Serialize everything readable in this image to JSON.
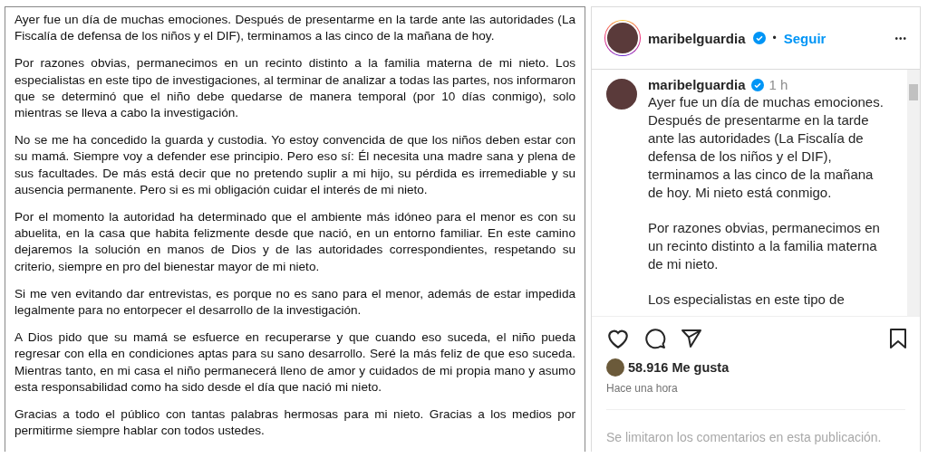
{
  "document": {
    "paragraphs": [
      "Ayer fue un día de muchas emociones. Después de presentarme en la tarde ante las autoridades (La Fiscalía de defensa de los niños y el DIF), terminamos a las cinco de la mañana de hoy.",
      "Por razones obvias, permanecimos en un recinto distinto a la familia materna de mi nieto. Los especialistas en este tipo de investigaciones, al terminar de analizar a todas las partes, nos informaron que se determinó que el niño debe quedarse de manera temporal (por 10 días conmigo), solo mientras se lleva a cabo la investigación.",
      "No se me ha concedido la guarda y custodia. Yo estoy convencida de que los niños deben estar con su mamá. Siempre voy a defender ese principio. Pero eso sí: Él necesita una madre sana y plena de sus facultades. De más está decir que no pretendo suplir a mi hijo, su pérdida es irremediable y su ausencia permanente. Pero si es mi obligación cuidar el interés de mi nieto.",
      "Por el momento la autoridad ha determinado que el ambiente más idóneo para el menor es con su abuelita, en la casa que habita felizmente desde que nació, en un entorno familiar. En este camino dejaremos la solución en manos de Dios y de las autoridades correspondientes, respetando su criterio, siempre en pro del bienestar mayor de mi nieto.",
      "Si me ven evitando dar entrevistas, es porque no es sano para el menor, además de estar impedida legalmente para no entorpecer el desarrollo de la investigación.",
      "A Dios pido que su mamá se esfuerce en recuperarse y que cuando eso suceda, el niño pueda regresar con ella en condiciones aptas para su sano desarrollo. Seré la más feliz de que eso suceda. Mientras tanto, en mi casa el niño permanecerá lleno de amor y cuidados de mi propia mano y asumo esta responsabilidad como ha sido desde el día que nació mi nieto.",
      "Gracias a todo el público con tantas palabras hermosas para mi nieto. Gracias a los medios por permitirme siempre hablar con todos ustedes."
    ]
  },
  "post": {
    "header": {
      "username": "maribelguardia",
      "separator": "•",
      "follow": "Seguir",
      "more": "•••"
    },
    "caption": {
      "username": "maribelguardia",
      "time": "1 h",
      "paragraphs": [
        "Ayer fue un día de muchas emociones. Después de presentarme en la tarde ante las autoridades  (La Fiscalía de defensa de los niños y el DIF), terminamos a las cinco de la mañana de hoy. Mi nieto está conmigo.",
        "Por razones obvias, permanecimos en un recinto distinto a la familia materna de mi nieto.",
        "Los especialistas en este tipo de"
      ]
    },
    "liked": false,
    "saved": false,
    "likes": "58.916 Me gusta",
    "posted": "Hace una hora",
    "comments_notice": "Se limitaron los comentarios en esta publicación."
  }
}
